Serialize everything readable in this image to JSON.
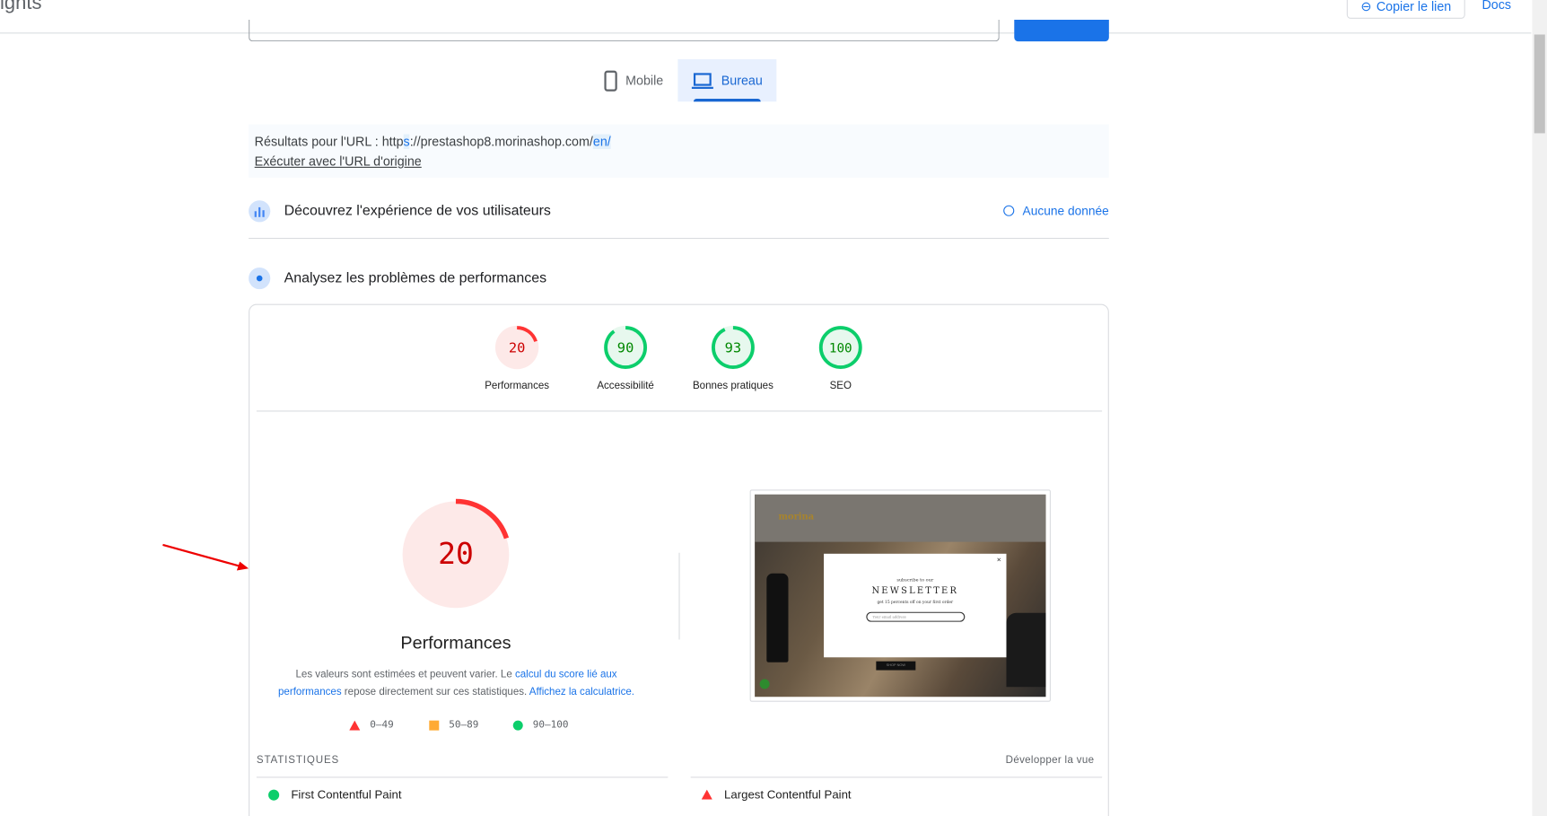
{
  "header": {
    "brand_fragment": "ights",
    "copy_link_label": "Copier le lien",
    "docs_label": "Docs"
  },
  "tabs": [
    {
      "label": "Mobile",
      "selected": false
    },
    {
      "label": "Bureau",
      "selected": true
    }
  ],
  "url_box": {
    "prefix": "Résultats pour l'URL : ",
    "url_a": "http",
    "url_b": "s",
    "url_c": "://prestashop8.morinashop.com/",
    "url_d": "en/",
    "origin_link": "Exécuter avec l'URL d'origine"
  },
  "sections": {
    "field_title": "Découvrez l'expérience de vos utilisateurs",
    "field_status": "Aucune donnée",
    "lab_title": "Analysez les problèmes de performances"
  },
  "scores": [
    {
      "label": "Performances",
      "value": 20,
      "rating": "fail"
    },
    {
      "label": "Accessibilité",
      "value": 90,
      "rating": "pass"
    },
    {
      "label": "Bonnes pratiques",
      "value": 93,
      "rating": "pass"
    },
    {
      "label": "SEO",
      "value": 100,
      "rating": "pass"
    }
  ],
  "main_gauge": {
    "value": 20,
    "title": "Performances"
  },
  "description": {
    "text1": "Les valeurs sont estimées et peuvent varier. Le ",
    "link1": "calcul du score lié aux performances",
    "text2": " repose directement sur ces statistiques. ",
    "link2": "Affichez la calculatrice."
  },
  "legend": [
    {
      "range": "0–49",
      "shape": "triangle",
      "color": "#ff3333"
    },
    {
      "range": "50–89",
      "shape": "square",
      "color": "#ffaa33"
    },
    {
      "range": "90–100",
      "shape": "circle",
      "color": "#0cce6b"
    }
  ],
  "screenshot": {
    "logo": "morina",
    "popup_pre": "subscribe to our",
    "popup_title": "NEWSLETTER",
    "popup_sub": "get 15 percents off on your first order",
    "popup_input": "Your email address",
    "cta": "SHOP NOW"
  },
  "stats": {
    "heading": "STATISTIQUES",
    "expand_label": "Développer la vue",
    "metrics": [
      {
        "name": "First Contentful Paint",
        "rating": "pass"
      },
      {
        "name": "Largest Contentful Paint",
        "rating": "fail"
      }
    ]
  },
  "colors": {
    "fail": "#ff3333",
    "fail_bg": "#fde9e8",
    "fail_text": "#cc0000",
    "pass": "#0cce6b",
    "pass_bg": "#e7f8ee",
    "pass_text": "#008800",
    "accent": "#1a73e8"
  }
}
